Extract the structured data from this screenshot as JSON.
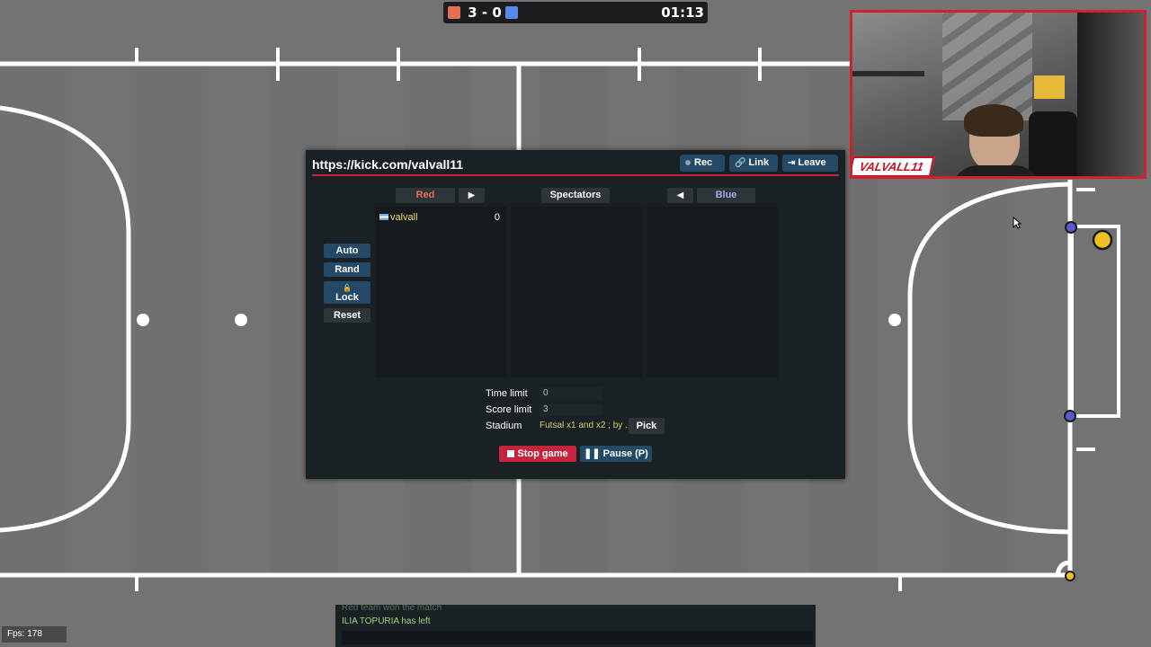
{
  "scoreboard": {
    "score": "3 - 0",
    "time": "01:13",
    "red_color": "#e56e56",
    "blue_color": "#5689e5"
  },
  "webcam": {
    "logo_text": "VALVALL11"
  },
  "room": {
    "url": "https://kick.com/valvall11",
    "header_buttons": {
      "rec": "Rec",
      "link": "Link",
      "leave": "Leave"
    },
    "teams": {
      "red_label": "Red",
      "spectators_label": "Spectators",
      "blue_label": "Blue",
      "red_players": [
        {
          "name": "valvall",
          "score": "0"
        }
      ]
    },
    "side_buttons": {
      "auto": "Auto",
      "rand": "Rand",
      "lock": "Lock",
      "reset": "Reset"
    },
    "settings": {
      "time_limit_label": "Time limit",
      "time_limit_value": "0",
      "score_limit_label": "Score limit",
      "score_limit_value": "3",
      "stadium_label": "Stadium",
      "stadium_value": "Futsal x1 and x2 ; by ...",
      "pick_label": "Pick"
    },
    "game_buttons": {
      "stop": "Stop game",
      "pause": "Pause (P)"
    }
  },
  "chat": {
    "faded_message": "Red team won the match",
    "last_message": "ILIA TOPURIA has left"
  },
  "fps_text": "Fps: 178",
  "colors": {
    "accent_red": "#c4243c",
    "button_blue": "#244967",
    "dialog_bg": "#1a2125",
    "field_gray": "#717171",
    "ball_yellow": "#f0c020",
    "player_blue": "#5a5ad0"
  }
}
